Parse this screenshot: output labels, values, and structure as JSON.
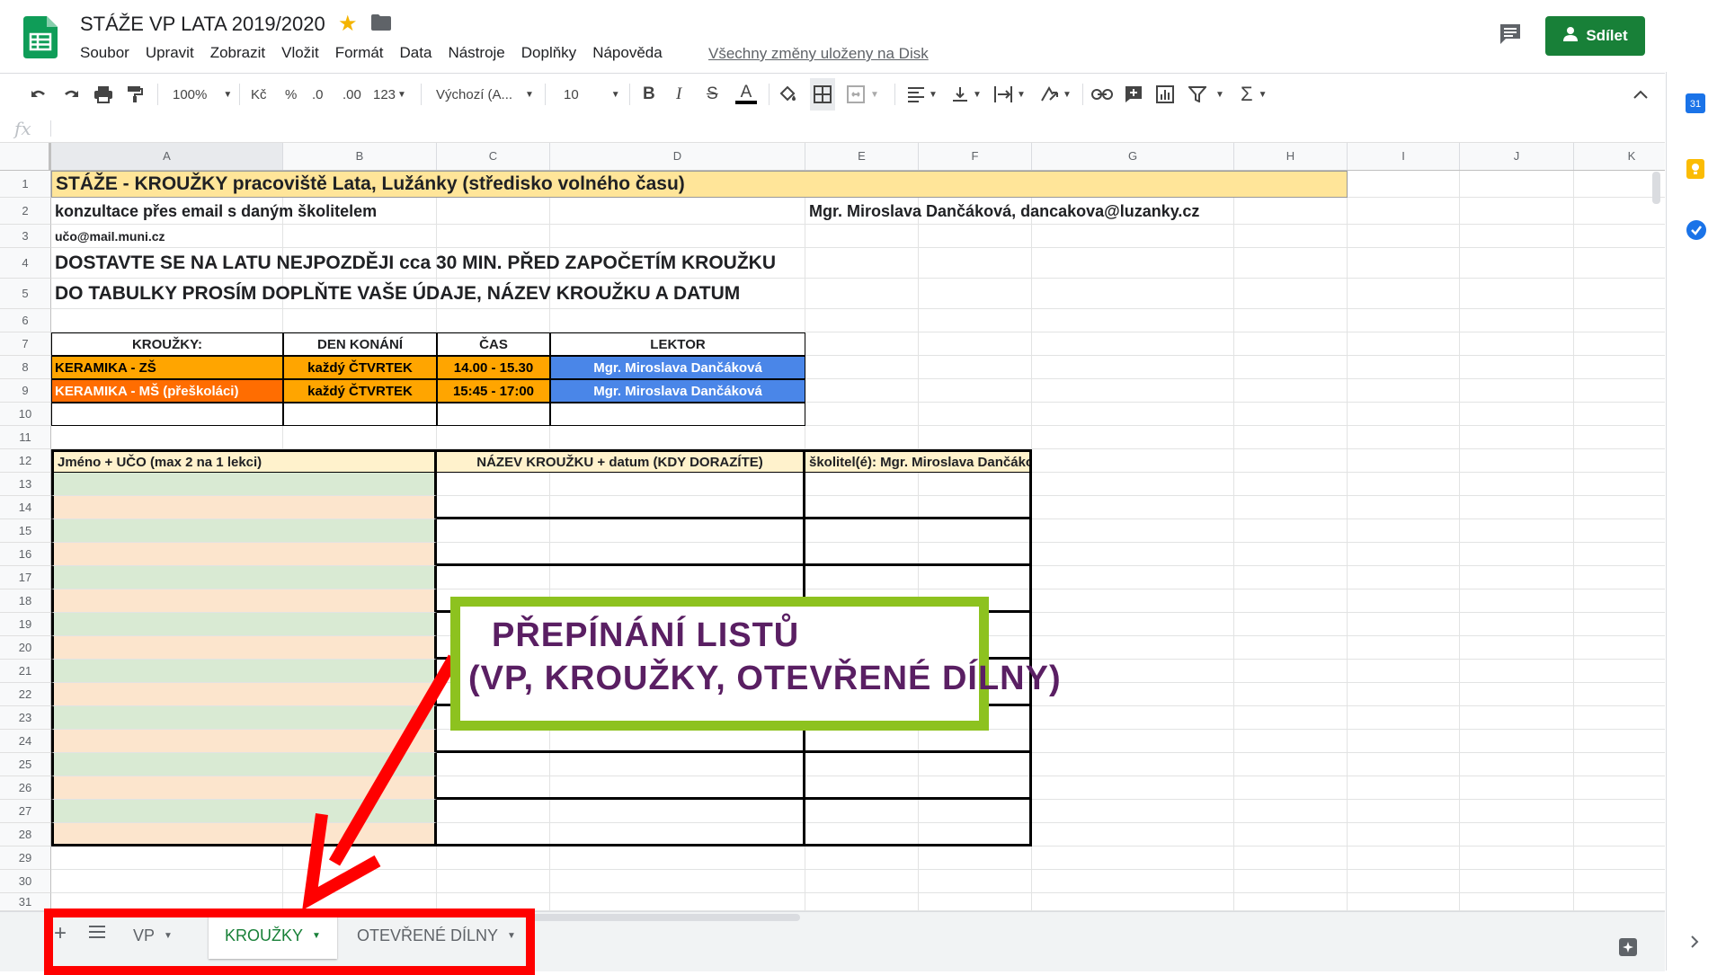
{
  "app": {
    "title": "STÁŽE VP LATA 2019/2020",
    "menu": [
      "Soubor",
      "Upravit",
      "Zobrazit",
      "Vložit",
      "Formát",
      "Data",
      "Nástroje",
      "Doplňky",
      "Nápověda"
    ],
    "saved_status": "Všechny změny uloženy na Disk",
    "share_label": "Sdílet",
    "accent_color": "#188038"
  },
  "toolbar": {
    "zoom": "100%",
    "currency": "Kč",
    "percent": "%",
    "dec_decrease": ".0",
    "dec_increase": ".00",
    "number_format": "123",
    "font": "Výchozí (A...",
    "font_size": "10",
    "bold": "B",
    "italic": "I",
    "strike": "S",
    "text_color": "A"
  },
  "formula_bar": {
    "fx": "fx"
  },
  "columns": [
    "A",
    "B",
    "C",
    "D",
    "E",
    "F",
    "G",
    "H",
    "I",
    "J",
    "K"
  ],
  "rows": [
    "1",
    "2",
    "3",
    "4",
    "5",
    "6",
    "7",
    "8",
    "9",
    "10",
    "11",
    "12",
    "13",
    "14",
    "15",
    "16",
    "17",
    "18",
    "19",
    "20",
    "21",
    "22",
    "23",
    "24",
    "25",
    "26",
    "27",
    "28",
    "29",
    "30",
    "31"
  ],
  "cells": {
    "r1": "STÁŽE - KROUŽKY pracoviště Lata, Lužánky (středisko volného času)",
    "r2_a": "konzultace přes email s daným školitelem",
    "r2_e": "Mgr. Miroslava Dančáková, dancakova@luzanky.cz",
    "r3": "učo@mail.muni.cz",
    "r4": "DOSTAVTE SE NA LATU NEJPOZDĚJI cca 30 MIN. PŘED ZAPOČETÍM KROUŽKU",
    "r5": "DO TABULKY PROSÍM DOPLŇTE VAŠE ÚDAJE, NÁZEV KROUŽKU A DATUM"
  },
  "schedule": {
    "headers": [
      "KROUŽKY:",
      "DEN KONÁNÍ",
      "ČAS",
      "LEKTOR"
    ],
    "rows": [
      [
        "KERAMIKA - ZŠ",
        "každý ČTVRTEK",
        "14.00 - 15.30",
        "Mgr. Miroslava Dančáková"
      ],
      [
        "KERAMIKA - MŠ (přeškoláci)",
        "každý ČTVRTEK",
        "15:45 - 17:00",
        "Mgr. Miroslava Dančáková"
      ]
    ],
    "colors": {
      "orange": "#ffa500",
      "dark_orange": "#ff6d01",
      "blue": "#4a86e8"
    }
  },
  "signup": {
    "headers": [
      "Jméno + UČO (max 2 na 1 lekci)",
      "NÁZEV KROUŽKU + datum (KDY DORAZÍTE)",
      "školitel(é): Mgr. Miroslava Dančáková"
    ],
    "colors": {
      "header_bg": "#fff2cc",
      "green": "#d9ead3",
      "peach": "#fce5cd"
    }
  },
  "sheet_tabs": [
    "VP",
    "KROUŽKY",
    "OTEVŘENÉ DÍLNY"
  ],
  "active_tab": "KROUŽKY",
  "annotation": {
    "line1": "PŘEPÍNÁNÍ LISTŮ",
    "line2": "(VP, KROUŽKY, OTEVŘENÉ DÍLNY)",
    "border_color": "#8dc21f",
    "text_color": "#5a1f63",
    "highlight_color": "#ff0000"
  },
  "side_panel": {
    "calendar_day": "31"
  }
}
